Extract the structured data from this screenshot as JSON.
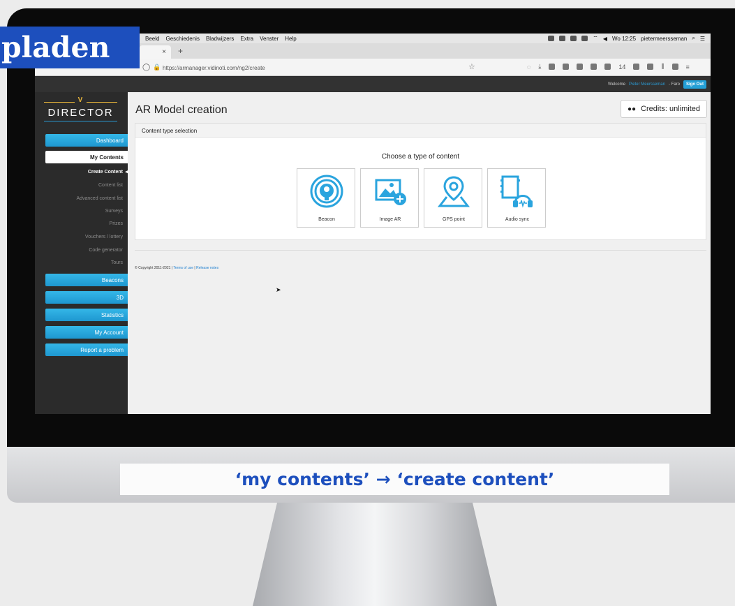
{
  "overlay": {
    "label": "pladen"
  },
  "caption": "‘my contents’ → ‘create content’",
  "mac_menubar": {
    "items": [
      "Beeld",
      "Geschiedenis",
      "Bladwijzers",
      "Extra",
      "Venster",
      "Help"
    ],
    "clock": "Wo 12:25",
    "user": "pietermeersseman"
  },
  "browser": {
    "tab_close": "×",
    "new_tab": "+",
    "url": "https://armanager.vidinoti.com/ng2/create",
    "toolbar_badge": "14"
  },
  "site_header": {
    "welcome_prefix": "Welcome",
    "user_name": "Pieter Meersseman",
    "org_suffix": "- Faro",
    "sign_out": "Sign Out"
  },
  "logo": {
    "text": "DIRECTOR",
    "mark": "V"
  },
  "sidebar": {
    "dashboard": "Dashboard",
    "my_contents": "My Contents",
    "sub_items": [
      "Create Content",
      "Content list",
      "Advanced content list",
      "Surveys",
      "Prizes",
      "Vouchers / lottery",
      "Code generator",
      "Tours"
    ],
    "beacons": "Beacons",
    "three_d": "3D",
    "statistics": "Statistics",
    "my_account": "My Account",
    "report": "Report a problem"
  },
  "main": {
    "title": "AR Model creation",
    "credits": "Credits: unlimited",
    "panel_heading": "Content type selection",
    "choose_heading": "Choose a type of content",
    "cards": [
      "Beacon",
      "Image AR",
      "GPS point",
      "Audio sync"
    ]
  },
  "footer": {
    "copyright": "© Copyright 2011-2021 |",
    "terms": "Terms of use",
    "sep": "|",
    "release": "Release notes"
  },
  "colors": {
    "accent": "#24a0d7",
    "caption_blue": "#1d4fbd",
    "logo_gold": "#e8b53a"
  }
}
